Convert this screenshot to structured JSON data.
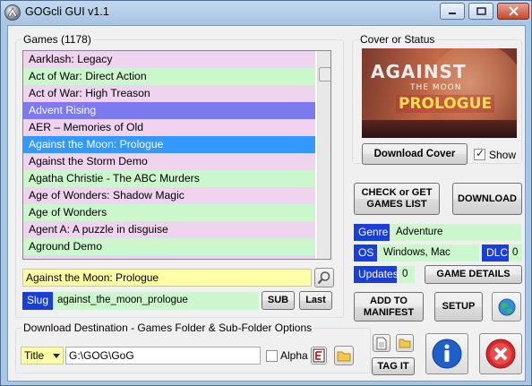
{
  "window": {
    "title": "GOGcli GUI v1.1"
  },
  "games": {
    "legend": "Games  (1178)",
    "items": [
      {
        "label": "Aarklash: Legacy",
        "style": "pink"
      },
      {
        "label": "Act of War: Direct Action",
        "style": "green"
      },
      {
        "label": "Act of War: High Treason",
        "style": "pink"
      },
      {
        "label": "Advent Rising",
        "style": "purple"
      },
      {
        "label": "AER – Memories of Old",
        "style": "pink"
      },
      {
        "label": "Against the Moon: Prologue",
        "style": "sel"
      },
      {
        "label": "Against the Storm Demo",
        "style": "pink"
      },
      {
        "label": "Agatha Christie - The ABC Murders",
        "style": "green"
      },
      {
        "label": "Age of Wonders: Shadow Magic",
        "style": "pink"
      },
      {
        "label": "Age of Wonders",
        "style": "green"
      },
      {
        "label": "Agent A: A puzzle in disguise",
        "style": "pink"
      },
      {
        "label": "Aground Demo",
        "style": "green"
      },
      {
        "label": "",
        "style": "pink"
      }
    ],
    "title_field": "Against the Moon: Prologue",
    "slug_label": "Slug",
    "slug_value": "against_the_moon_prologue",
    "sub_button": "SUB",
    "last_button": "Last"
  },
  "cover": {
    "legend": "Cover or Status",
    "image_text_line1": "AGAINST",
    "image_text_line2": "THE MOON",
    "image_text_line3": "PROLOGUE",
    "download_cover_button": "Download Cover",
    "show_label": "Show",
    "show_checked": true
  },
  "actions": {
    "check_get_button": "CHECK or GET GAMES LIST",
    "download_button": "DOWNLOAD",
    "game_details_button": "GAME DETAILS",
    "add_to_manifest_button": "ADD TO MANIFEST",
    "setup_button": "SETUP",
    "tag_it_button": "TAG IT"
  },
  "details": {
    "genre_label": "Genre",
    "genre_value": "Adventure",
    "os_label": "OS",
    "os_value": "Windows, Mac",
    "dlc_label": "DLC",
    "dlc_value": "0",
    "updates_label": "Updates",
    "updates_value": "0"
  },
  "destination": {
    "legend": "Download Destination - Games Folder & Sub-Folder Options",
    "folder_option_selected": "Title",
    "path_value": "G:\\GOG\\GoG",
    "alpha_label": "Alpha",
    "alpha_checked": false
  },
  "colors": {
    "row_pink": "#efd3ef",
    "row_green": "#ccf7cc",
    "row_purple": "#7b7bef",
    "row_selected": "#3399ff",
    "tag_blue": "#1a3fd6",
    "title_field_bg": "#ffffa8"
  }
}
